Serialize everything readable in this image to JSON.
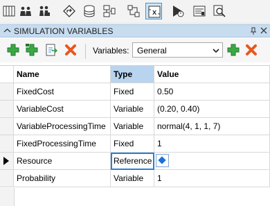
{
  "colors": {
    "accent": "#3c8fd6",
    "panel_header": "#c7dcef",
    "selected_header": "#b9d4ee",
    "add_green": "#2e9e3a",
    "delete_orange": "#e8571e"
  },
  "top_toolbar": {
    "icons": [
      "processes-icon",
      "entities-icon",
      "resources-icon",
      "decision-icon",
      "data-icon",
      "flowchart-icon",
      "hierarchy-icon",
      "variables-icon",
      "simulation-run-icon",
      "report-icon",
      "search-icon"
    ],
    "active": "variables-icon"
  },
  "panel": {
    "title": "SIMULATION VARIABLES"
  },
  "toolbar": {
    "icons": [
      "add-icon",
      "add-child-icon",
      "import-icon",
      "delete-icon"
    ],
    "variables_label": "Variables:",
    "variables_selected": "General",
    "add_icon": "add-icon",
    "delete_icon": "delete-icon"
  },
  "table": {
    "headers": {
      "name": "Name",
      "type": "Type",
      "value": "Value"
    },
    "rows": [
      {
        "name": "FixedCost",
        "type": "Fixed",
        "value": "0.50"
      },
      {
        "name": "VariableCost",
        "type": "Variable",
        "value": "(0.20, 0.40)"
      },
      {
        "name": "VariableProcessingTime",
        "type": "Variable",
        "value": "normal(4, 1, 1, 7)"
      },
      {
        "name": "FixedProcessingTime",
        "type": "Fixed",
        "value": "1"
      },
      {
        "name": "Resource",
        "type": "Reference",
        "value": ""
      },
      {
        "name": "Probability",
        "type": "Variable",
        "value": "1"
      }
    ],
    "current_row": 4
  }
}
